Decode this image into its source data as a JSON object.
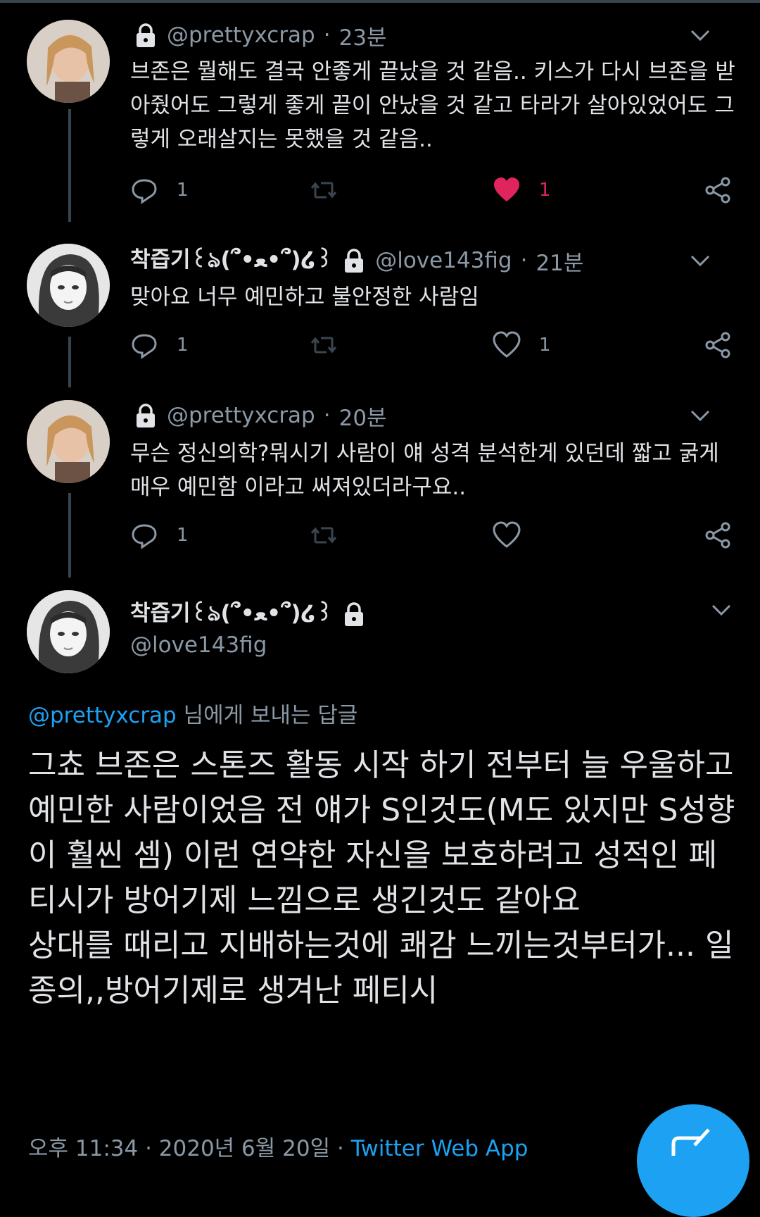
{
  "tweets": [
    {
      "name": "",
      "handle": "@prettyxcrap",
      "time": "23분",
      "text": "브존은 뭘해도 결국 안좋게 끝났을 것 같음.. 키스가 다시 브존을 받아줬어도 그렇게 좋게 끝이 안났을 것 같고 타라가 살아있었어도 그렇게 오래살지는 못했을 것 같음..",
      "reply_count": "1",
      "like_count": "1",
      "liked": true
    },
    {
      "name": "착즙기꒰ঌ(՞•ﻌ•՞)໒꒱",
      "handle": "@love143fig",
      "time": "21분",
      "text": "맞아요 너무 예민하고 불안정한 사람임",
      "reply_count": "1",
      "like_count": "1",
      "liked": false
    },
    {
      "name": "",
      "handle": "@prettyxcrap",
      "time": "20분",
      "text": "무슨 정신의학?뭐시기 사람이 얘 성격 분석한게 있던데 짧고 굵게 매우 예민함 이라고 써져있더라구요..",
      "reply_count": "1",
      "like_count": "",
      "liked": false
    }
  ],
  "main": {
    "name": "착즙기꒰ঌ(՞•ﻌ•՞)໒꒱",
    "handle": "@love143fig",
    "replying_mention": "@prettyxcrap",
    "replying_suffix": " 님에게 보내는 답글",
    "text": "그쵸 브존은 스톤즈 활동 시작 하기 전부터 늘 우울하고 예민한 사람이었음 전 얘가 S인것도(M도 있지만 S성향이 훨씬 셈) 이런 연약한 자신을 보호하려고 성적인 페티시가 방어기제 느낌으로 생긴것도 같아요\n상대를 때리고 지배하는것에 쾌감 느끼는것부터가... 일종의,,방어기제로 생겨난 페티시",
    "timestamp": "오후 11:34 · 2020년 6월 20일",
    "dot": " · ",
    "source": "Twitter Web App"
  },
  "icons": {
    "reply": "reply-icon",
    "retweet": "retweet-icon",
    "like": "heart-icon",
    "share": "share-icon",
    "lock": "lock-icon",
    "caret": "chevron-down-icon",
    "compose": "compose-icon"
  },
  "colors": {
    "background": "#000000",
    "text": "#e1e3e6",
    "muted": "#8b98a5",
    "accent": "#1da1f2",
    "like": "#e0245e",
    "divider": "#38444d"
  }
}
